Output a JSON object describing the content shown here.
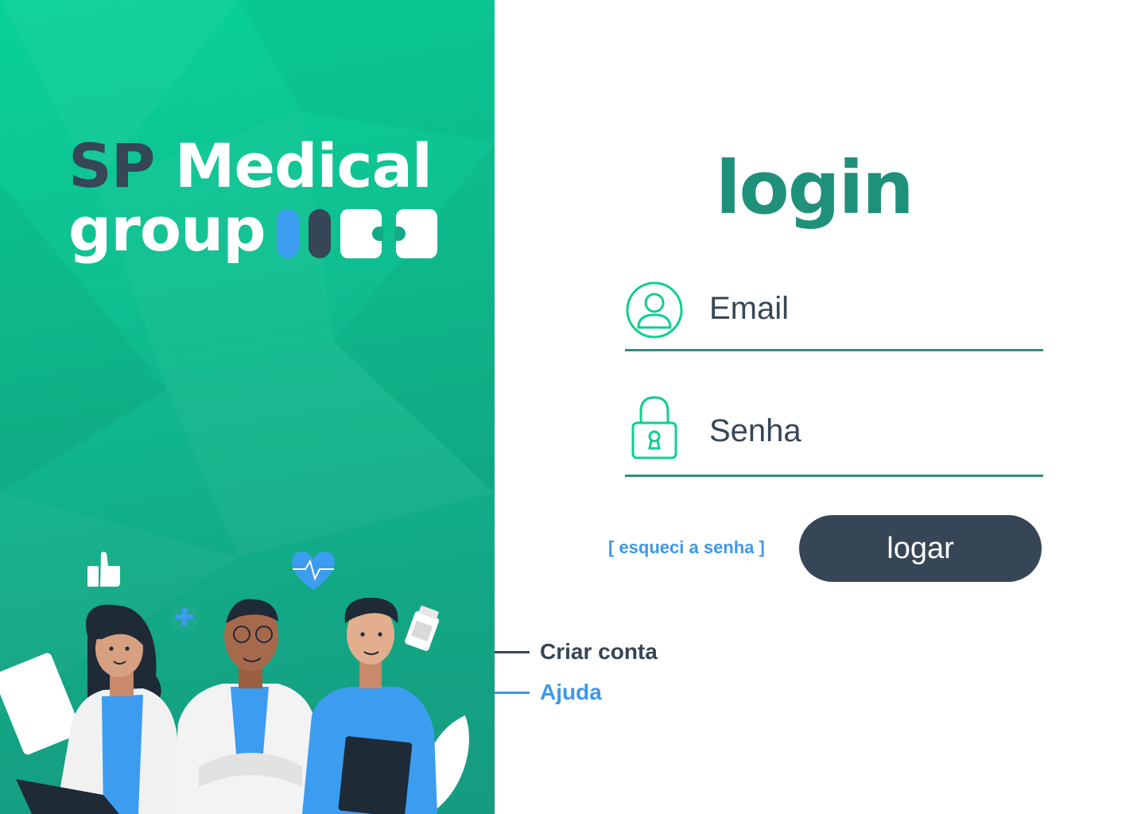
{
  "brand": {
    "line1_sp": "SP",
    "line1_medical": "Medical",
    "line2_group": "group",
    "colors": {
      "dark": "#364656",
      "blue": "#3c9cf0",
      "white": "#ffffff"
    }
  },
  "left_panel": {
    "background_colors": [
      "#08d199",
      "#169a80"
    ],
    "illustration": "three-doctors-illustration"
  },
  "login": {
    "title": "login",
    "email": {
      "placeholder": "Email",
      "value": "",
      "icon": "user-icon"
    },
    "password": {
      "placeholder": "Senha",
      "value": "",
      "icon": "lock-icon"
    },
    "forgot_label": "[ esqueci a senha ]",
    "submit_label": "logar"
  },
  "links": {
    "create_account": "Criar conta",
    "help": "Ajuda"
  },
  "colors": {
    "accent": "#1f917a",
    "dark": "#364656",
    "link_blue": "#3d98e8",
    "icon_green": "#0fcf92"
  }
}
